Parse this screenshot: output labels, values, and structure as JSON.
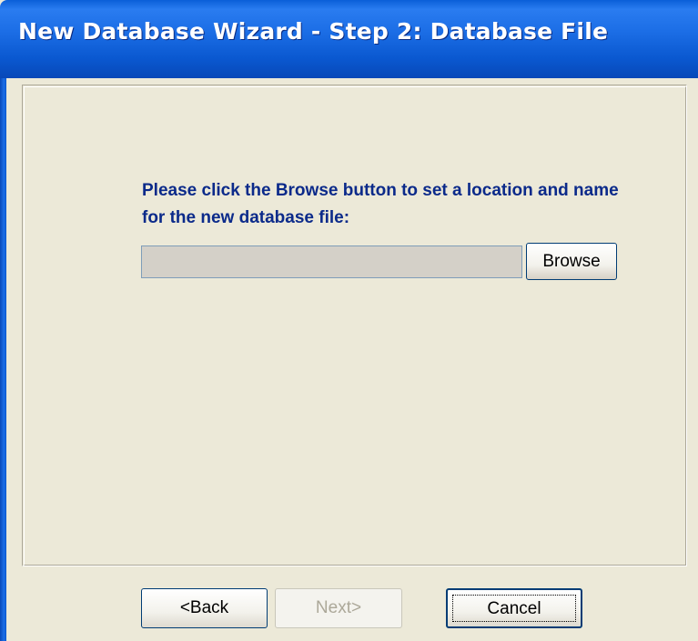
{
  "window": {
    "title": "New Database Wizard - Step 2: Database File"
  },
  "step": {
    "instruction": "Please click the Browse button to set a location and name for the new database file:",
    "file_path_value": "",
    "browse_label": "Browse"
  },
  "footer": {
    "back_label": "<Back",
    "next_label": "Next>",
    "cancel_label": "Cancel",
    "next_enabled": false
  },
  "colors": {
    "titlebar": "#0a58d0",
    "instruction_text": "#0b2a8a",
    "window_bg": "#ece9d8"
  }
}
